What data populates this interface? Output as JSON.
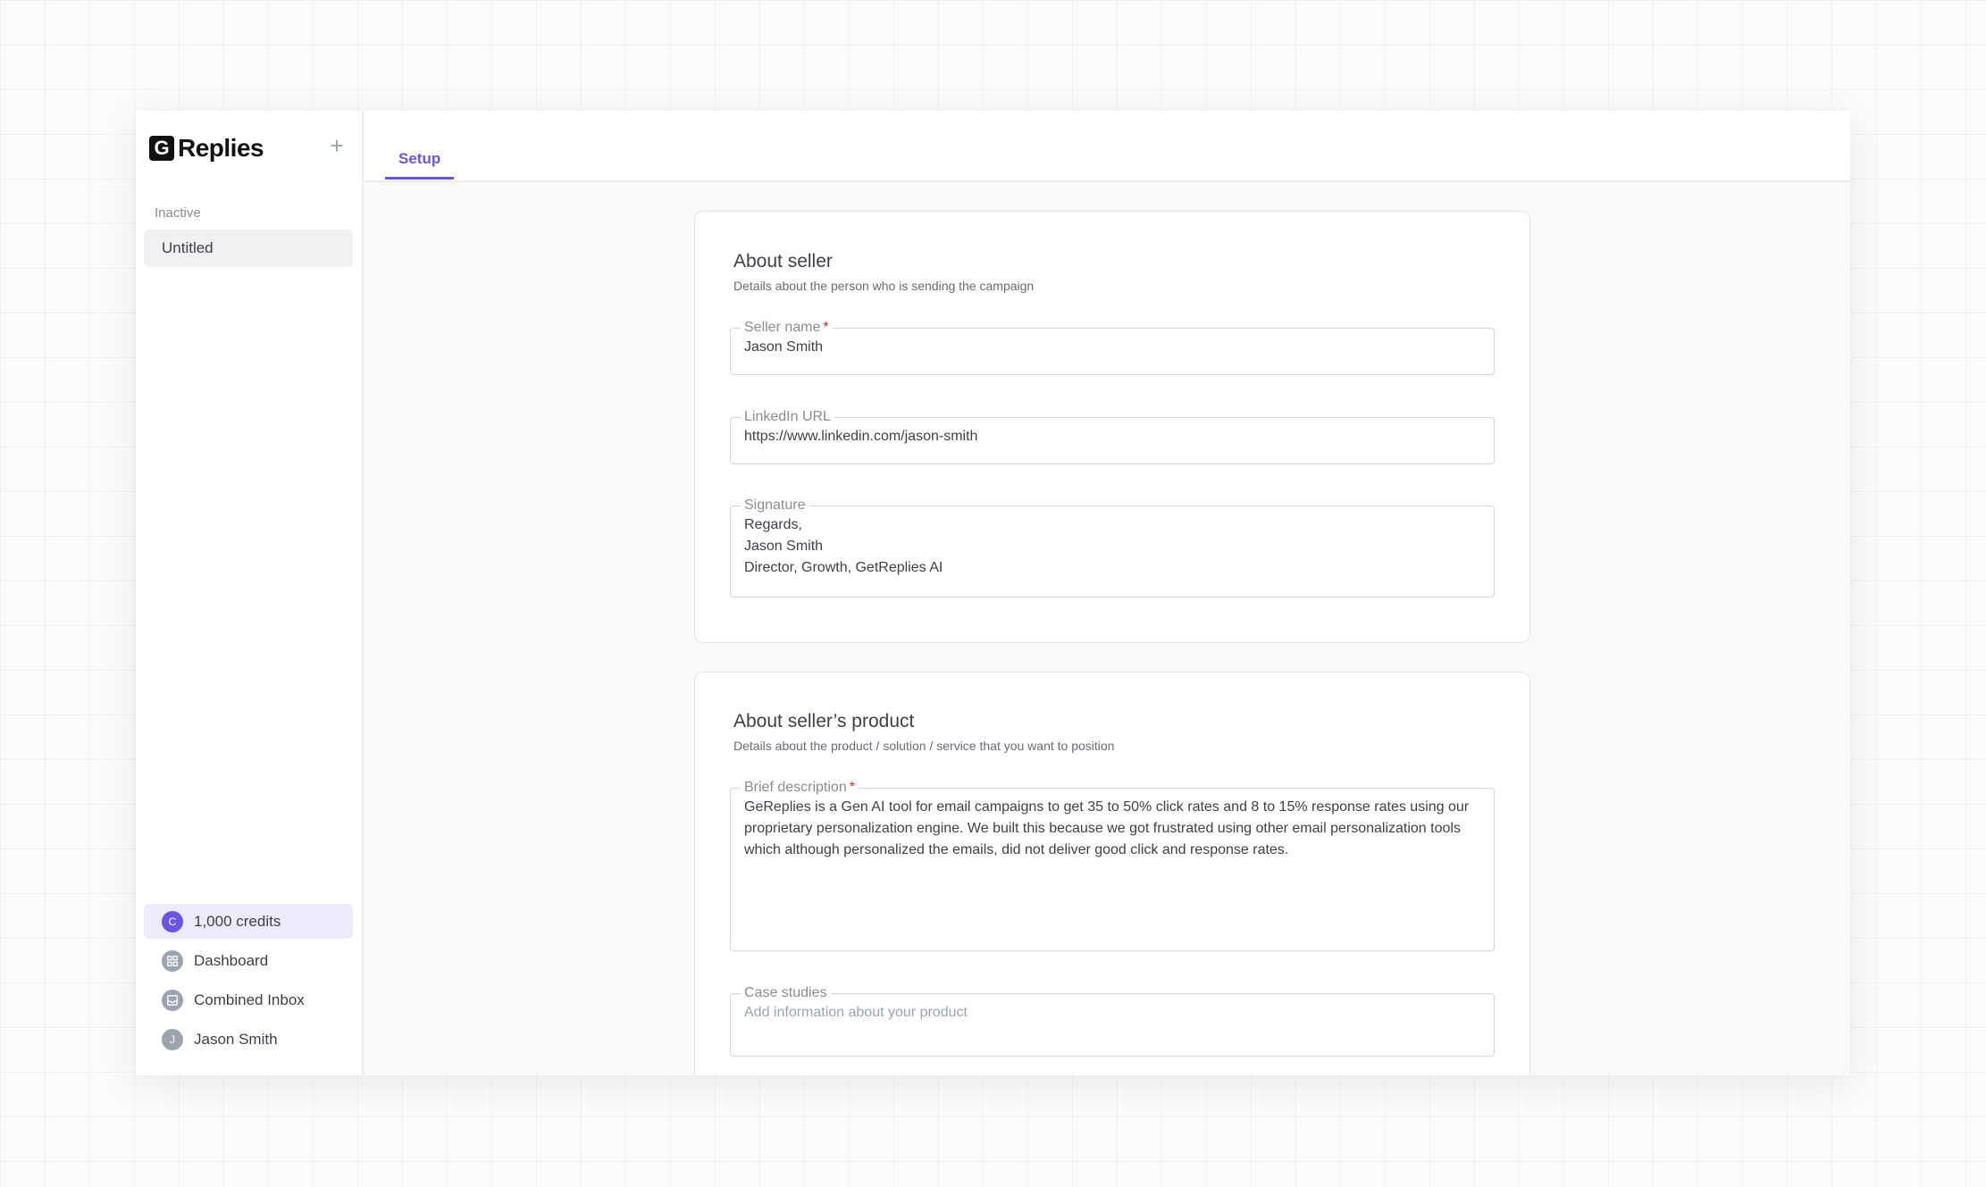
{
  "brand": {
    "mark": "G",
    "name": "Replies"
  },
  "sidebar": {
    "add_label": "+",
    "section_label": "Inactive",
    "campaign_item": "Untitled",
    "bottom": {
      "credits": {
        "icon_letter": "C",
        "label": "1,000 credits"
      },
      "dashboard": {
        "label": "Dashboard",
        "icon": "grid-icon"
      },
      "inbox": {
        "label": "Combined Inbox",
        "icon": "inbox-icon"
      },
      "user": {
        "icon_letter": "J",
        "label": "Jason Smith"
      }
    }
  },
  "tabs": [
    {
      "label": "Setup",
      "active": true
    }
  ],
  "seller": {
    "title": "About seller",
    "subtitle": "Details about the person who is sending the campaign",
    "name": {
      "label": "Seller name",
      "required": "*",
      "value": "Jason Smith"
    },
    "linkedin": {
      "label": "LinkedIn URL",
      "value": "https://www.linkedin.com/jason-smith"
    },
    "signature": {
      "label": "Signature",
      "value": "Regards,\nJason Smith\nDirector, Growth, GetReplies AI"
    }
  },
  "product": {
    "title": "About seller’s product",
    "subtitle": "Details about the product / solution / service that you want to position",
    "description": {
      "label": "Brief description",
      "required": "*",
      "value": "GeReplies is a Gen AI tool for email campaigns to get 35 to 50% click rates and 8 to 15% response rates using our proprietary personalization engine. We built this because we got frustrated using other email personalization tools which although personalized the emails, did not deliver good click and response rates."
    },
    "case_studies": {
      "label": "Case studies",
      "placeholder": "Add information about your product"
    }
  },
  "colors": {
    "accent": "#6b55e0",
    "required": "#dc2626"
  }
}
